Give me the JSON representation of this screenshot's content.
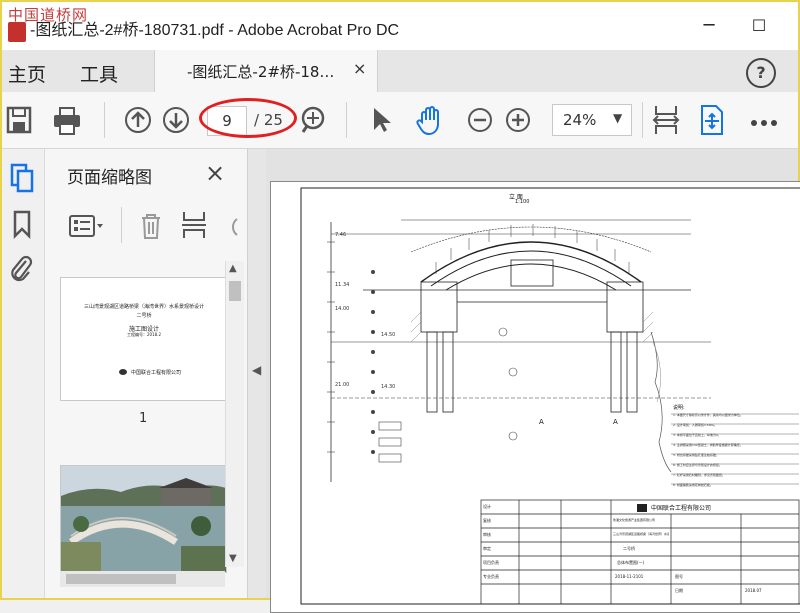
{
  "window": {
    "watermark": "中国道桥网",
    "title": "-图纸汇总-2#桥-180731.pdf - Adobe Acrobat Pro DC",
    "minimize": "─",
    "maximize": "☐"
  },
  "tabs": {
    "home": "主页",
    "tools": "工具",
    "document": "-图纸汇总-2#桥-18…",
    "close": "×",
    "help": "?"
  },
  "toolbar": {
    "page_current": "9",
    "page_total": "/ 25",
    "zoom": "24%",
    "zoom_caret": "▼"
  },
  "thumbnails": {
    "title": "页面缩略图",
    "close": "×",
    "page1_label": "1",
    "page1_lines": [
      "三山湾景观湖区道路桥梁（海湾世界）水系景观桥设计",
      "二号桥",
      "施工图设计",
      "工程编号：2018.2"
    ],
    "page1_company": "中国联合工程有限公司",
    "collapse_arrow": "◀"
  },
  "drawing": {
    "view_title": "立 面",
    "scale": "1:100",
    "section_a": "A",
    "section_a2": "A",
    "company": "中国联合工程有限公司",
    "client": "鲁湘文化旅游产业集团有限公司",
    "project": "三山湾景观湖区道路桥梁（海湾世界）水系景观桥设计",
    "bridge": "二号桥",
    "sheet": "总体布置图(一)",
    "notes_title": "说明:",
    "elev_labels": [
      "7.46",
      "11.34",
      "14.00",
      "14.50",
      "21.00",
      "14.30"
    ],
    "notes": [
      "1. 本图尺寸除标高以米计外，其余均以厘米为单位。",
      "2. 设计荷载：人群荷载3.5kPa。",
      "3. 本桥平面位于直线上，纵坡为0。",
      "4. 主拱圈采用C40混凝土，拱肋厚度根据计算确定。",
      "5. 桥台基础采用钻孔灌注桩基础。",
      "6. 施工时应注意与景观设计的衔接。",
      "7. 栏杆采用石材雕刻，详见景观图纸。",
      "8. 桥面铺装采用花岗岩石板。",
      "9. 地基承载力应满足设计要求。",
      "10. 其余未尽事宜按现行规范执行。"
    ],
    "table_cells": [
      "设计",
      "复核",
      "审核",
      "审定",
      "项目负责",
      "专业负责",
      "图号",
      "日期"
    ],
    "drawing_no": "2018-11-2101",
    "date": "2018.07"
  }
}
